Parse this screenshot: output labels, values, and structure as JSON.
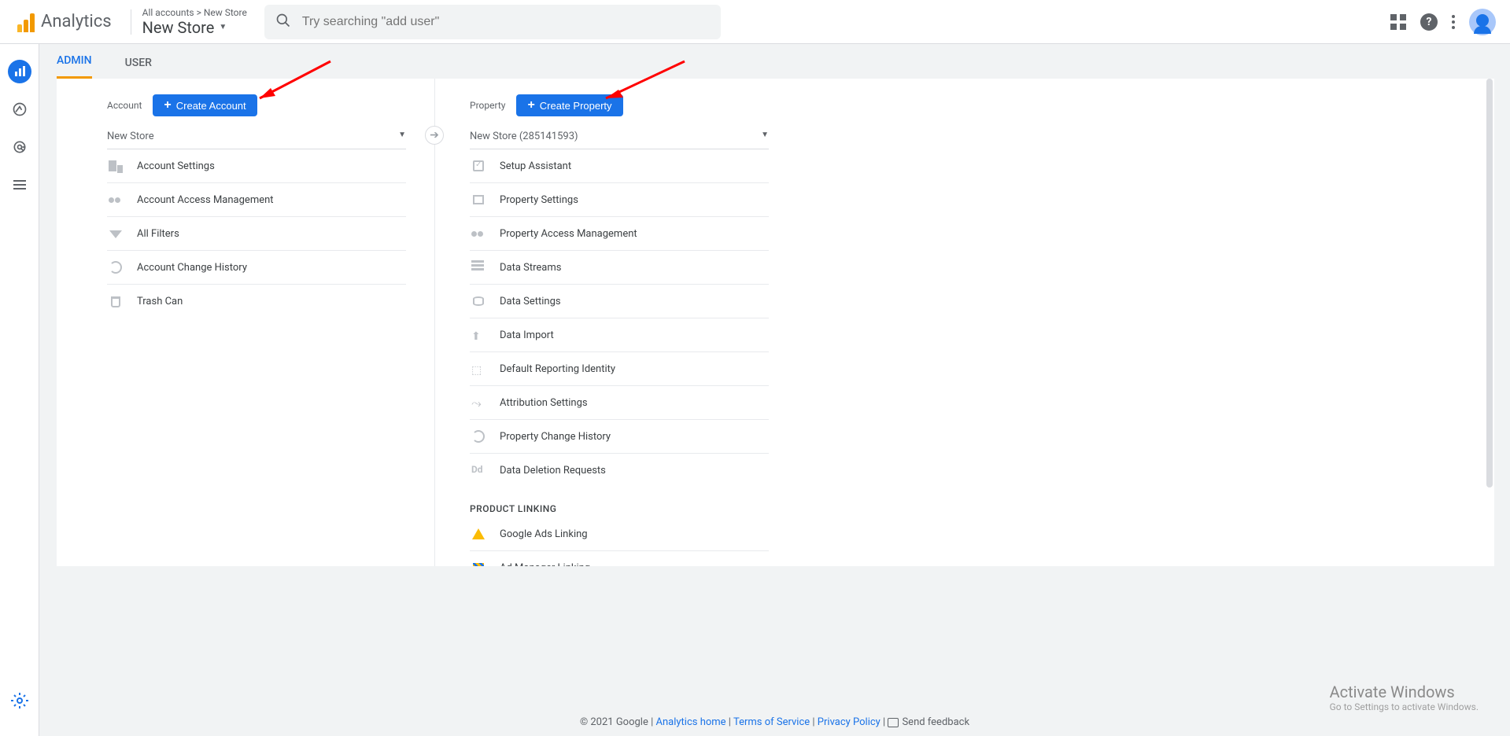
{
  "header": {
    "product": "Analytics",
    "account_path": "All accounts > New Store",
    "account_name": "New Store",
    "search_placeholder": "Try searching \"add user\""
  },
  "tabs": {
    "admin": "ADMIN",
    "user": "USER"
  },
  "account_col": {
    "label": "Account",
    "create_btn": "Create Account",
    "selected": "New Store",
    "items": [
      {
        "icon": "building",
        "label": "Account Settings"
      },
      {
        "icon": "group",
        "label": "Account Access Management"
      },
      {
        "icon": "funnel",
        "label": "All Filters"
      },
      {
        "icon": "history",
        "label": "Account Change History"
      },
      {
        "icon": "trash",
        "label": "Trash Can"
      }
    ]
  },
  "property_col": {
    "label": "Property",
    "create_btn": "Create Property",
    "selected": "New Store (285141593)",
    "items": [
      {
        "icon": "check",
        "label": "Setup Assistant"
      },
      {
        "icon": "prop",
        "label": "Property Settings"
      },
      {
        "icon": "group",
        "label": "Property Access Management"
      },
      {
        "icon": "stream",
        "label": "Data Streams"
      },
      {
        "icon": "db",
        "label": "Data Settings"
      },
      {
        "icon": "upload",
        "label": "Data Import"
      },
      {
        "icon": "id",
        "label": "Default Reporting Identity"
      },
      {
        "icon": "attr",
        "label": "Attribution Settings"
      },
      {
        "icon": "history",
        "label": "Property Change History"
      },
      {
        "icon": "dd",
        "label": "Data Deletion Requests"
      }
    ],
    "section_header": "PRODUCT LINKING",
    "linking_items": [
      {
        "icon": "ads",
        "label": "Google Ads Linking"
      },
      {
        "icon": "am",
        "label": "Ad Manager Linking"
      }
    ]
  },
  "footer": {
    "copyright": "© 2021 Google",
    "home": "Analytics home",
    "tos": "Terms of Service",
    "privacy": "Privacy Policy",
    "feedback": "Send feedback"
  },
  "watermark": {
    "l1": "Activate Windows",
    "l2": "Go to Settings to activate Windows."
  }
}
